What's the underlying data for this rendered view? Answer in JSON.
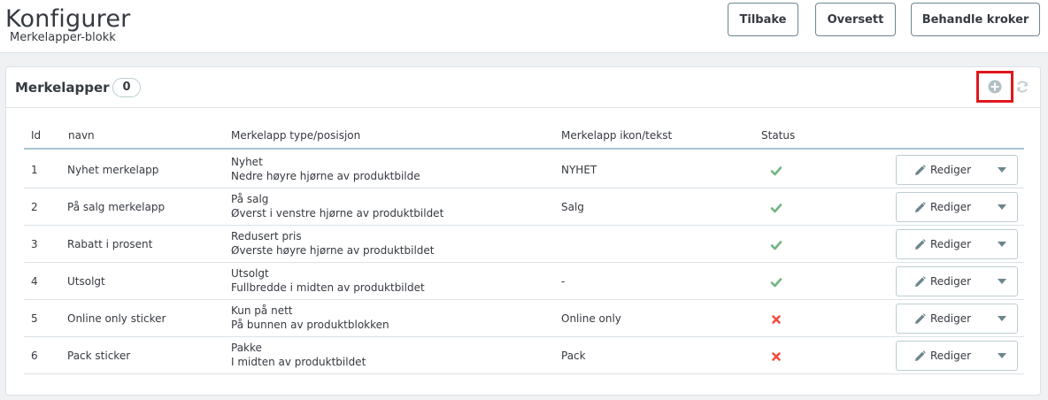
{
  "header": {
    "title": "Konfigurer",
    "subtitle": "Merkelapper-blokk",
    "buttons": {
      "back": "Tilbake",
      "translate": "Oversett",
      "hooks": "Behandle kroker"
    }
  },
  "panel": {
    "title": "Merkelapper",
    "count": "0",
    "add_icon": "plus-circle-icon",
    "refresh_icon": "refresh-icon"
  },
  "table": {
    "columns": {
      "id": "Id",
      "name": "navn",
      "type": "Merkelapp type/posisjon",
      "icon_text": "Merkelapp ikon/tekst",
      "status": "Status"
    },
    "edit_label": "Rediger",
    "rows": [
      {
        "id": "1",
        "name": "Nyhet merkelapp",
        "type": "Nyhet",
        "position": "Nedre høyre hjørne av produktbilde",
        "icon_text": "NYHET",
        "status": "enabled"
      },
      {
        "id": "2",
        "name": "På salg merkelapp",
        "type": "På salg",
        "position": "Øverst i venstre hjørne av produktbildet",
        "icon_text": "Salg",
        "status": "enabled"
      },
      {
        "id": "3",
        "name": "Rabatt i prosent",
        "type": "Redusert pris",
        "position": "Øverste høyre hjørne av produktbildet",
        "icon_text": "",
        "status": "enabled"
      },
      {
        "id": "4",
        "name": "Utsolgt",
        "type": "Utsolgt",
        "position": "Fullbredde i midten av produktbildet",
        "icon_text": "-",
        "status": "enabled"
      },
      {
        "id": "5",
        "name": "Online only sticker",
        "type": "Kun på nett",
        "position": "På bunnen av produktblokken",
        "icon_text": "Online only",
        "status": "disabled"
      },
      {
        "id": "6",
        "name": "Pack sticker",
        "type": "Pakke",
        "position": "I midten av produktbildet",
        "icon_text": "Pack",
        "status": "disabled"
      }
    ]
  },
  "colors": {
    "enabled": "#70b580",
    "disabled": "#f54c3e",
    "highlight": "#e0161d",
    "accent": "#25b9d7"
  }
}
